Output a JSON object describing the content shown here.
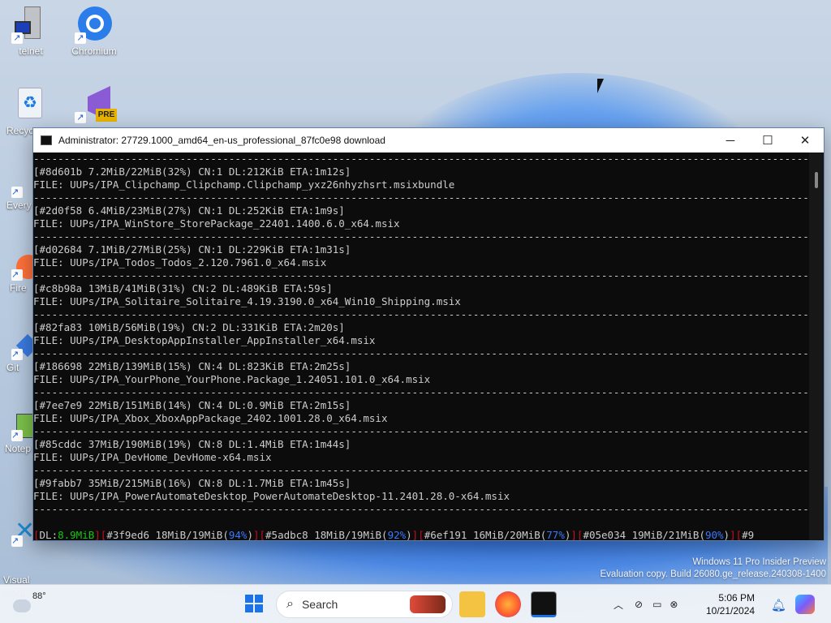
{
  "desktop": {
    "icons": [
      {
        "label": "telnet",
        "icon": "computer-icon"
      },
      {
        "label": "Chromium",
        "icon": "chromium-icon"
      },
      {
        "label": "Recyc",
        "icon": "recycle-bin-icon"
      },
      {
        "label": "",
        "icon": "visual-studio-pre-icon",
        "badge": "PRE"
      },
      {
        "label": "Every",
        "icon": "everything-icon"
      },
      {
        "label": "Fire",
        "icon": "firefox-icon"
      },
      {
        "label": "Git",
        "icon": "git-icon"
      },
      {
        "label": "Notep",
        "icon": "notepad-icon"
      },
      {
        "label": "Visual\nCode",
        "icon": "vscode-icon"
      }
    ]
  },
  "window": {
    "title": "Administrator:  27729.1000_amd64_en-us_professional_87fc0e98 download",
    "controls": {
      "minimize": "─",
      "maximize": "☐",
      "close": "✕"
    }
  },
  "console": {
    "separator": "---------------------------------------------------------------------------------------------------------------------------------",
    "entries": [
      {
        "status": "[#8d601b 7.2MiB/22MiB(32%) CN:1 DL:212KiB ETA:1m12s]",
        "file": "FILE: UUPs/IPA_Clipchamp_Clipchamp.Clipchamp_yxz26nhyzhsrt.msixbundle"
      },
      {
        "status": "[#2d0f58 6.4MiB/23MiB(27%) CN:1 DL:252KiB ETA:1m9s]",
        "file": "FILE: UUPs/IPA_WinStore_StorePackage_22401.1400.6.0_x64.msix"
      },
      {
        "status": "[#d02684 7.1MiB/27MiB(25%) CN:1 DL:229KiB ETA:1m31s]",
        "file": "FILE: UUPs/IPA_Todos_Todos_2.120.7961.0_x64.msix"
      },
      {
        "status": "[#c8b98a 13MiB/41MiB(31%) CN:2 DL:489KiB ETA:59s]",
        "file": "FILE: UUPs/IPA_Solitaire_Solitaire_4.19.3190.0_x64_Win10_Shipping.msix"
      },
      {
        "status": "[#82fa83 10MiB/56MiB(19%) CN:2 DL:331KiB ETA:2m20s]",
        "file": "FILE: UUPs/IPA_DesktopAppInstaller_AppInstaller_x64.msix"
      },
      {
        "status": "[#186698 22MiB/139MiB(15%) CN:4 DL:823KiB ETA:2m25s]",
        "file": "FILE: UUPs/IPA_YourPhone_YourPhone.Package_1.24051.101.0_x64.msix"
      },
      {
        "status": "[#7ee7e9 22MiB/151MiB(14%) CN:4 DL:0.9MiB ETA:2m15s]",
        "file": "FILE: UUPs/IPA_Xbox_XboxAppPackage_2402.1001.28.0_x64.msix"
      },
      {
        "status": "[#85cddc 37MiB/190MiB(19%) CN:8 DL:1.4MiB ETA:1m44s]",
        "file": "FILE: UUPs/IPA_DevHome_DevHome-x64.msix"
      },
      {
        "status": "[#9fabb7 35MiB/215MiB(16%) CN:8 DL:1.7MiB ETA:1m45s]",
        "file": "FILE: UUPs/IPA_PowerAutomateDesktop_PowerAutomateDesktop-11.2401.28.0-x64.msix"
      }
    ],
    "summary": {
      "dl_label": "DL:",
      "dl_value": "8.9MiB",
      "items": [
        {
          "id": "#3f9ed6 18MiB/19MiB",
          "pct": "94%"
        },
        {
          "id": "#5adbc8 18MiB/19MiB",
          "pct": "92%"
        },
        {
          "id": "#6ef191 16MiB/20MiB",
          "pct": "77%"
        },
        {
          "id": "#05e034 19MiB/21MiB",
          "pct": "90%"
        }
      ],
      "tail": "#9"
    }
  },
  "watermark": {
    "line1": "Windows 11 Pro Insider Preview",
    "line2": "Evaluation copy. Build 26080.ge_release.240308-1400"
  },
  "taskbar": {
    "weather_temp": "88°",
    "search_placeholder": "Search",
    "time": "5:06 PM",
    "date": "10/21/2024"
  }
}
